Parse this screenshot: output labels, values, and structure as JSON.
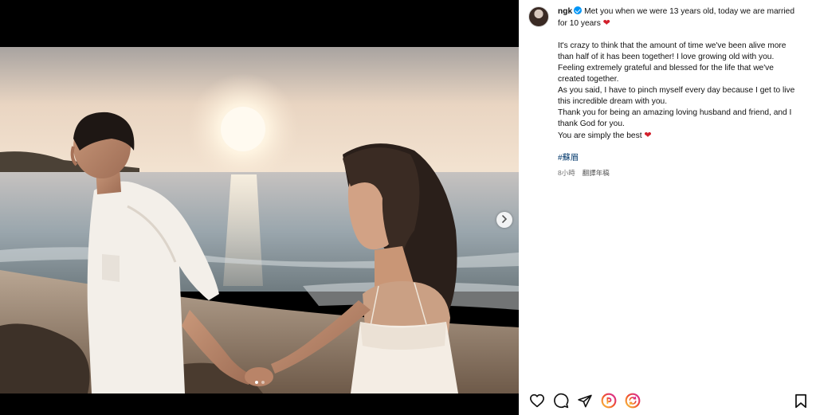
{
  "post": {
    "username": "ngk",
    "caption_first": "Met you when we were 13 years old, today we are married for 10 years",
    "caption_lines": [
      "It's crazy to think that the amount of time we've been alive more",
      "than half of it has been together! I love growing old with you.",
      "Feeling extremely grateful and blessed for the life that we've",
      "created together.",
      "As you said, I have to pinch myself every day because I get to live",
      "this incredible dream with you.",
      "Thank you for being an amazing loving husband and friend, and I",
      "thank God for you.",
      "You are simply the best"
    ],
    "heart_emoji": "❤",
    "hashtag": "#蘇眉",
    "time_ago": "8小時",
    "translate_label": "翻譯年稿"
  },
  "carousel": {
    "count": 2,
    "active_index": 0,
    "next_icon": "chevron-right-icon"
  },
  "actions": {
    "icons": [
      "heart-icon",
      "comment-icon",
      "share-icon",
      "threads-icon",
      "threads-refresh-icon",
      "bookmark-icon"
    ]
  },
  "colors": {
    "verified": "#0095f6",
    "heart": "#d21f2b",
    "hashtag": "#00376b",
    "meta": "#737373",
    "threads_gradient_start": "#f9c33c",
    "threads_gradient_end": "#d6249f"
  }
}
